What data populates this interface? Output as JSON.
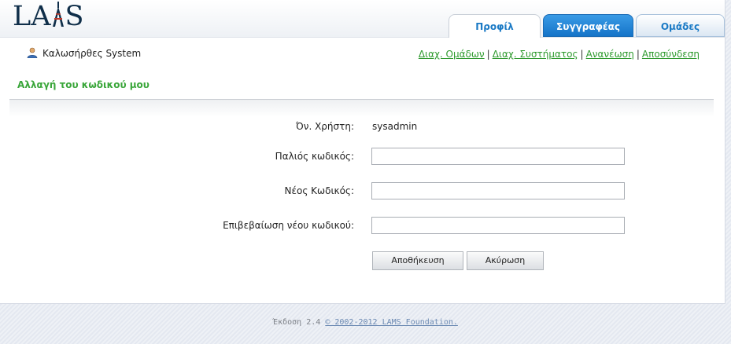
{
  "header": {
    "logo_text_left": "LA",
    "logo_text_right": "S",
    "tabs": [
      {
        "label": "Προφίλ",
        "active": true
      },
      {
        "label": "Συγγραφέας",
        "active": false
      },
      {
        "label": "Ομάδες",
        "active": false
      }
    ]
  },
  "welcome": {
    "text": "Καλωσήρθες System",
    "icon": "user-icon"
  },
  "nav": {
    "links": [
      "Διαχ. Ομάδων",
      "Διαχ. Συστήματος",
      "Ανανέωση",
      "Αποσύνδεση"
    ],
    "separator": "|"
  },
  "section": {
    "title": "Αλλαγή του κωδικού μου"
  },
  "form": {
    "username_label": "Όν. Χρήστη:",
    "username_value": "sysadmin",
    "old_password_label": "Παλιός κωδικός:",
    "new_password_label": "Νέος Κωδικός:",
    "confirm_password_label": "Επιβεβαίωση νέου κωδικού:",
    "old_password_value": "",
    "new_password_value": "",
    "confirm_password_value": ""
  },
  "buttons": {
    "save": "Αποθήκευση",
    "cancel": "Ακύρωση"
  },
  "footer": {
    "version": "Έκδοση 2.4",
    "copyright_link": "© 2002-2012 LAMS Foundation."
  },
  "colors": {
    "accent_green": "#3aa63a",
    "tab_blue": "#1574c8",
    "link_green": "#2e9a2e"
  }
}
